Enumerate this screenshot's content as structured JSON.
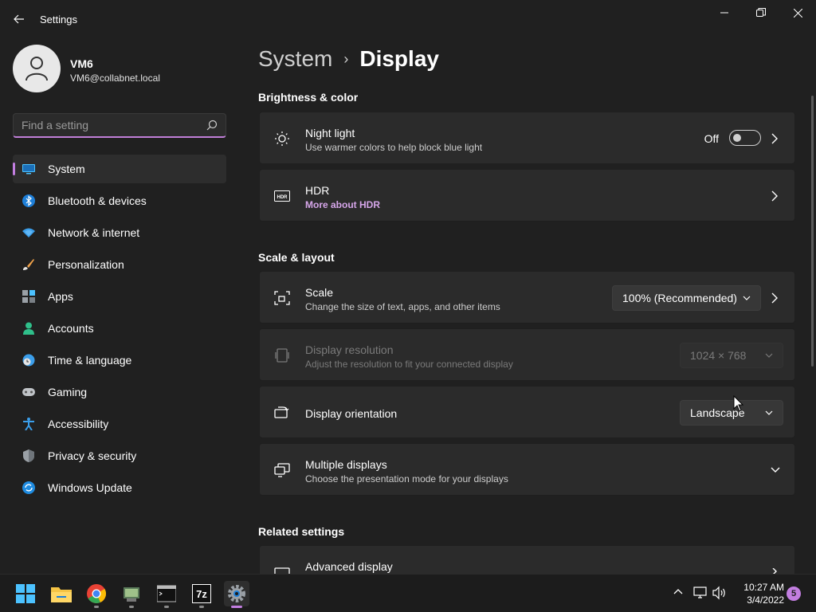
{
  "window": {
    "title": "Settings"
  },
  "profile": {
    "name": "VM6",
    "email": "VM6@collabnet.local"
  },
  "search": {
    "placeholder": "Find a setting"
  },
  "nav": {
    "items": [
      {
        "label": "System",
        "icon": "system-icon",
        "active": true
      },
      {
        "label": "Bluetooth & devices",
        "icon": "bluetooth-icon"
      },
      {
        "label": "Network & internet",
        "icon": "wifi-icon"
      },
      {
        "label": "Personalization",
        "icon": "brush-icon"
      },
      {
        "label": "Apps",
        "icon": "apps-icon"
      },
      {
        "label": "Accounts",
        "icon": "accounts-icon"
      },
      {
        "label": "Time & language",
        "icon": "clock-globe-icon"
      },
      {
        "label": "Gaming",
        "icon": "gamepad-icon"
      },
      {
        "label": "Accessibility",
        "icon": "accessibility-icon"
      },
      {
        "label": "Privacy & security",
        "icon": "shield-icon"
      },
      {
        "label": "Windows Update",
        "icon": "update-icon"
      }
    ]
  },
  "breadcrumb": {
    "parent": "System",
    "separator": "›",
    "current": "Display"
  },
  "sections": {
    "brightness": "Brightness & color",
    "scale_layout": "Scale & layout",
    "related": "Related settings"
  },
  "cards": {
    "night_light": {
      "title": "Night light",
      "subtitle": "Use warmer colors to help block blue light",
      "toggle_label": "Off",
      "toggle_on": false
    },
    "hdr": {
      "title": "HDR",
      "subtitle": "More about HDR"
    },
    "scale": {
      "title": "Scale",
      "subtitle": "Change the size of text, apps, and other items",
      "value": "100% (Recommended)"
    },
    "resolution": {
      "title": "Display resolution",
      "subtitle": "Adjust the resolution to fit your connected display",
      "value": "1024 × 768",
      "disabled": true
    },
    "orientation": {
      "title": "Display orientation",
      "value": "Landscape"
    },
    "multiple": {
      "title": "Multiple displays",
      "subtitle": "Choose the presentation mode for your displays"
    },
    "advanced": {
      "title": "Advanced display"
    }
  },
  "taskbar": {
    "apps": [
      "start-icon",
      "file-explorer-icon",
      "chrome-icon",
      "app-icon",
      "terminal-icon",
      "7zip-icon",
      "settings-icon"
    ],
    "clock_time": "10:27 AM",
    "clock_date": "3/4/2022",
    "notification_count": "5"
  },
  "colors": {
    "accent": "#c27ee0",
    "background": "#202020",
    "card": "#2b2b2b"
  }
}
